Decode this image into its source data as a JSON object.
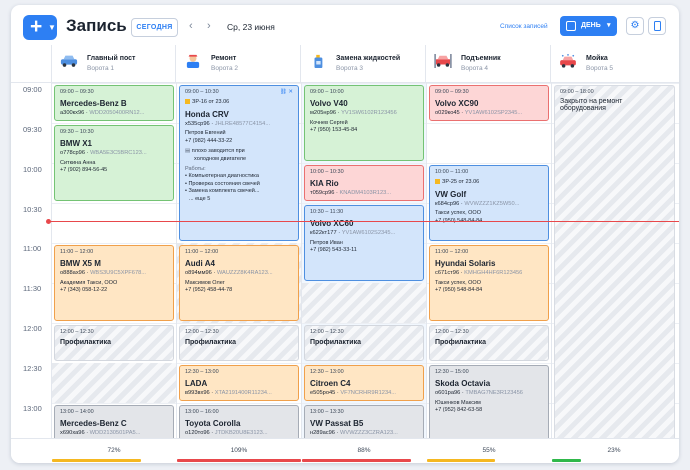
{
  "header": {
    "add_icon": "plus",
    "title": "Запись",
    "today_label": "СЕГОДНЯ",
    "prev_icon": "chevron-left",
    "next_icon": "chevron-right",
    "date": "Ср, 23 июня",
    "list_link": "Список записей",
    "view_label": "ДЕНЬ",
    "settings_icon": "gear",
    "mobile_icon": "phone"
  },
  "columns": [
    {
      "name": "Главный пост",
      "bay": "Ворота 1",
      "icon": "car-icon"
    },
    {
      "name": "Ремонт",
      "bay": "Ворота 2",
      "icon": "mechanic-icon"
    },
    {
      "name": "Замена жидкостей",
      "bay": "Ворота 3",
      "icon": "fluid-icon"
    },
    {
      "name": "Подъемник",
      "bay": "Ворота 4",
      "icon": "lift-icon"
    },
    {
      "name": "Мойка",
      "bay": "Ворота 5",
      "icon": "wash-icon"
    }
  ],
  "times": [
    "09:00",
    "09:30",
    "10:00",
    "10:30",
    "11:00",
    "11:30",
    "12:00",
    "12:30",
    "13:00"
  ],
  "appointments": {
    "c1a": {
      "time": "09:00 – 09:30",
      "car": "Mercedes-Benz B",
      "plate": "а300кх96",
      "vin": "WDD2050400RN12...",
      "status": "green"
    },
    "c1b": {
      "time": "09:30 – 10:30",
      "car": "BMW X1",
      "plate": "о778ср96",
      "vin": "WBA5E3C5BRC123...",
      "client": "Ситкина Анна",
      "phone": "+7 (902) 894-56-45",
      "status": "green"
    },
    "c1c": {
      "time": "11:00 – 12:00",
      "car": "BMW X5 M",
      "plate": "о888ах96",
      "vin": "WBS3U9C5XPF678...",
      "client": "Академия Такси, ООО",
      "phone": "+7 (343) 058-12-22",
      "status": "orange"
    },
    "c1d": {
      "time": "13:00 – 14:00",
      "car": "Mercedes-Benz C",
      "plate": "х690ха96",
      "vin": "WDD2130501PA5...",
      "status": "gray"
    },
    "c2a": {
      "time": "09:00 – 10:30",
      "badge": "ЗР-16 от 23.06",
      "car": "Honda CRV",
      "plate": "х535ср96",
      "vin": "JHLRE48577C4154...",
      "client": "Петров Евгений",
      "phone": "+7 (982) 444-33-22",
      "note1": "плохо заводится при",
      "note2": "холодном двигателе",
      "works_label": "Работы:",
      "work1": "• Компьютерная диагностика",
      "work2": "• Проверка состояния свечей",
      "work3": "• Замена комплекта свечей...",
      "more": "... еще 5",
      "status": "blue"
    },
    "c2b": {
      "time": "11:00 – 12:00",
      "car": "Audi A4",
      "plate": "о894мм96",
      "vin": "WAUZZZ8K4RA123...",
      "client": "Максимов Олег",
      "phone": "+7 (952) 458-44-78",
      "status": "orange"
    },
    "c2c": {
      "time": "12:00 – 12:30",
      "label": "Профилактика"
    },
    "c2d": {
      "time": "12:30 – 13:00",
      "car": "LADA",
      "plate": "в993вх96",
      "vin": "XTA2191400R11234...",
      "status": "orange"
    },
    "c2e": {
      "time": "13:00 – 16:00",
      "car": "Toyota Corolla",
      "plate": "о120то96",
      "vin": "JTDKB20U8E3123...",
      "status": "gray"
    },
    "c3a": {
      "time": "09:00 – 10:00",
      "car": "Volvo V40",
      "plate": "м205нр96",
      "vin": "YV1SW6102R123456",
      "client": "Кочнев Сергей",
      "phone": "+7 (950) 153-45-84",
      "status": "green"
    },
    "c3b": {
      "time": "10:00 – 10:30",
      "car": "KIA Rio",
      "plate": "т059ср96",
      "vin": "KNADM4103R123...",
      "status": "red"
    },
    "c3c": {
      "time": "10:30 – 11:30",
      "car": "Volvo XC60",
      "plate": "к622кт177",
      "vin": "YV1AW6102S2345...",
      "client": "Петров Иван",
      "phone": "+7 (982) 543-33-11",
      "status": "blue"
    },
    "c3d": {
      "time": "12:00 – 12:30",
      "label": "Профилактика"
    },
    "c3e": {
      "time": "12:30 – 13:00",
      "car": "Citroen C4",
      "plate": "е505ро45",
      "vin": "VF7NCRHR9R1234...",
      "status": "orange"
    },
    "c3f": {
      "time": "13:00 – 13:30",
      "car": "VW Passat B5",
      "plate": "н289ас96",
      "vin": "WVWZZZ3CZRA123...",
      "status": "gray"
    },
    "c4a": {
      "time": "09:00 – 09:30",
      "car": "Volvo XC90",
      "plate": "о029ко45",
      "vin": "YV1AW6102SP2345...",
      "status": "red"
    },
    "c4b": {
      "time": "10:00 – 11:00",
      "badge": "ЗР-25 от 23.06",
      "car": "VW Golf",
      "plate": "к684ср96",
      "vin": "WVWZZZ1KZ5W50...",
      "client": "Такси успех, ООО",
      "phone": "+7 (950) 548-84-84",
      "status": "blue"
    },
    "c4c": {
      "time": "11:00 – 12:00",
      "car": "Hyundai Solaris",
      "plate": "с671ст96",
      "vin": "KMHGH4HF6R123456",
      "client": "Такси успех, ООО",
      "phone": "+7 (950) 548-84-84",
      "status": "orange"
    },
    "c4d": {
      "time": "12:00 – 12:30",
      "label": "Профилактика"
    },
    "c4e": {
      "time": "12:30 – 15:00",
      "car": "Skoda Octavia",
      "plate": "о601ра96",
      "vin": "TMBAG7NE3R123456",
      "client": "Юшенков Максим",
      "phone": "+7 (952) 842-63-58",
      "status": "gray"
    },
    "c5a": {
      "time": "09:00 – 18:00",
      "note1": "Закрыто на ремонт",
      "note2": "оборудования"
    }
  },
  "footer": {
    "loads": [
      "72%",
      "109%",
      "88%",
      "55%",
      "23%"
    ],
    "load_values": [
      0.72,
      1.09,
      0.88,
      0.55,
      0.23
    ],
    "bar_colors": [
      "#f5b820",
      "#e8484b",
      "#e8484b",
      "#f5b820",
      "#2fb84a"
    ]
  }
}
